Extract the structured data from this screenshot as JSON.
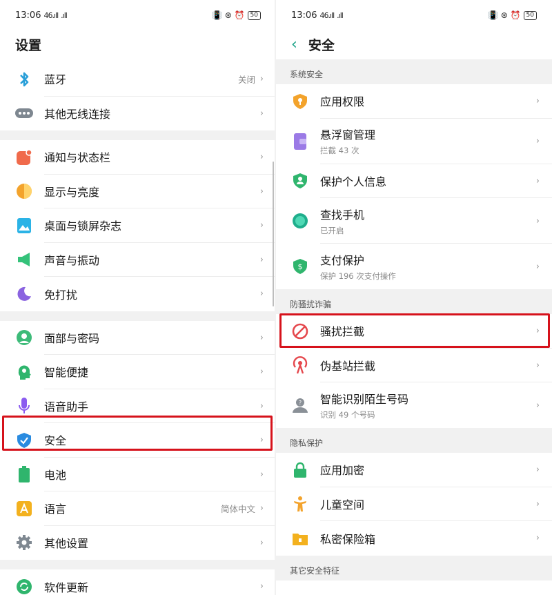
{
  "left": {
    "status": {
      "time": "13:06",
      "signal1": "46.ıll",
      "signal2": ".ıll",
      "icons": "📳 ⊛ ⏰",
      "battery": "50"
    },
    "title": "设置",
    "group1": [
      {
        "label": "蓝牙",
        "value": "关闭",
        "icon": "bluetooth-icon"
      },
      {
        "label": "其他无线连接",
        "icon": "more-dots-icon"
      }
    ],
    "group2": [
      {
        "label": "通知与状态栏",
        "icon": "notification-icon"
      },
      {
        "label": "显示与亮度",
        "icon": "brightness-icon"
      },
      {
        "label": "桌面与锁屏杂志",
        "icon": "wallpaper-icon"
      },
      {
        "label": "声音与振动",
        "icon": "speaker-icon"
      },
      {
        "label": "免打扰",
        "icon": "moon-icon"
      }
    ],
    "group3": [
      {
        "label": "面部与密码",
        "icon": "face-icon"
      },
      {
        "label": "智能便捷",
        "icon": "smart-head-icon"
      },
      {
        "label": "语音助手",
        "icon": "mic-icon"
      },
      {
        "label": "安全",
        "icon": "shield-check-icon"
      },
      {
        "label": "电池",
        "icon": "battery-icon"
      },
      {
        "label": "语言",
        "value": "简体中文",
        "icon": "language-icon"
      },
      {
        "label": "其他设置",
        "icon": "gear-icon"
      }
    ],
    "group4": [
      {
        "label": "软件更新",
        "icon": "update-icon"
      }
    ]
  },
  "right": {
    "status": {
      "time": "13:06",
      "signal1": "46.ıll",
      "signal2": ".ıll",
      "icons": "📳 ⊛ ⏰",
      "battery": "50"
    },
    "title": "安全",
    "sections": {
      "system": "系统安全",
      "anti": "防骚扰诈骗",
      "privacy": "隐私保护",
      "other": "其它安全特征"
    },
    "system_items": [
      {
        "label": "应用权限",
        "icon": "key-shield-icon"
      },
      {
        "label": "悬浮窗管理",
        "sub": "拦截 43 次",
        "icon": "floating-window-icon"
      },
      {
        "label": "保护个人信息",
        "icon": "person-shield-icon"
      },
      {
        "label": "查找手机",
        "sub": "已开启",
        "icon": "find-phone-icon"
      },
      {
        "label": "支付保护",
        "sub": "保护 196 次支付操作",
        "icon": "payment-shield-icon"
      }
    ],
    "anti_items": [
      {
        "label": "骚扰拦截",
        "icon": "block-icon"
      },
      {
        "label": "伪基站拦截",
        "icon": "antenna-icon"
      },
      {
        "label": "智能识别陌生号码",
        "sub": "识别 49 个号码",
        "icon": "unknown-caller-icon"
      }
    ],
    "privacy_items": [
      {
        "label": "应用加密",
        "icon": "lock-icon"
      },
      {
        "label": "儿童空间",
        "icon": "child-icon"
      },
      {
        "label": "私密保险箱",
        "icon": "safe-icon"
      }
    ]
  },
  "chevron": "›",
  "colors": {
    "highlight": "#d6121b",
    "accent": "#16a085"
  }
}
